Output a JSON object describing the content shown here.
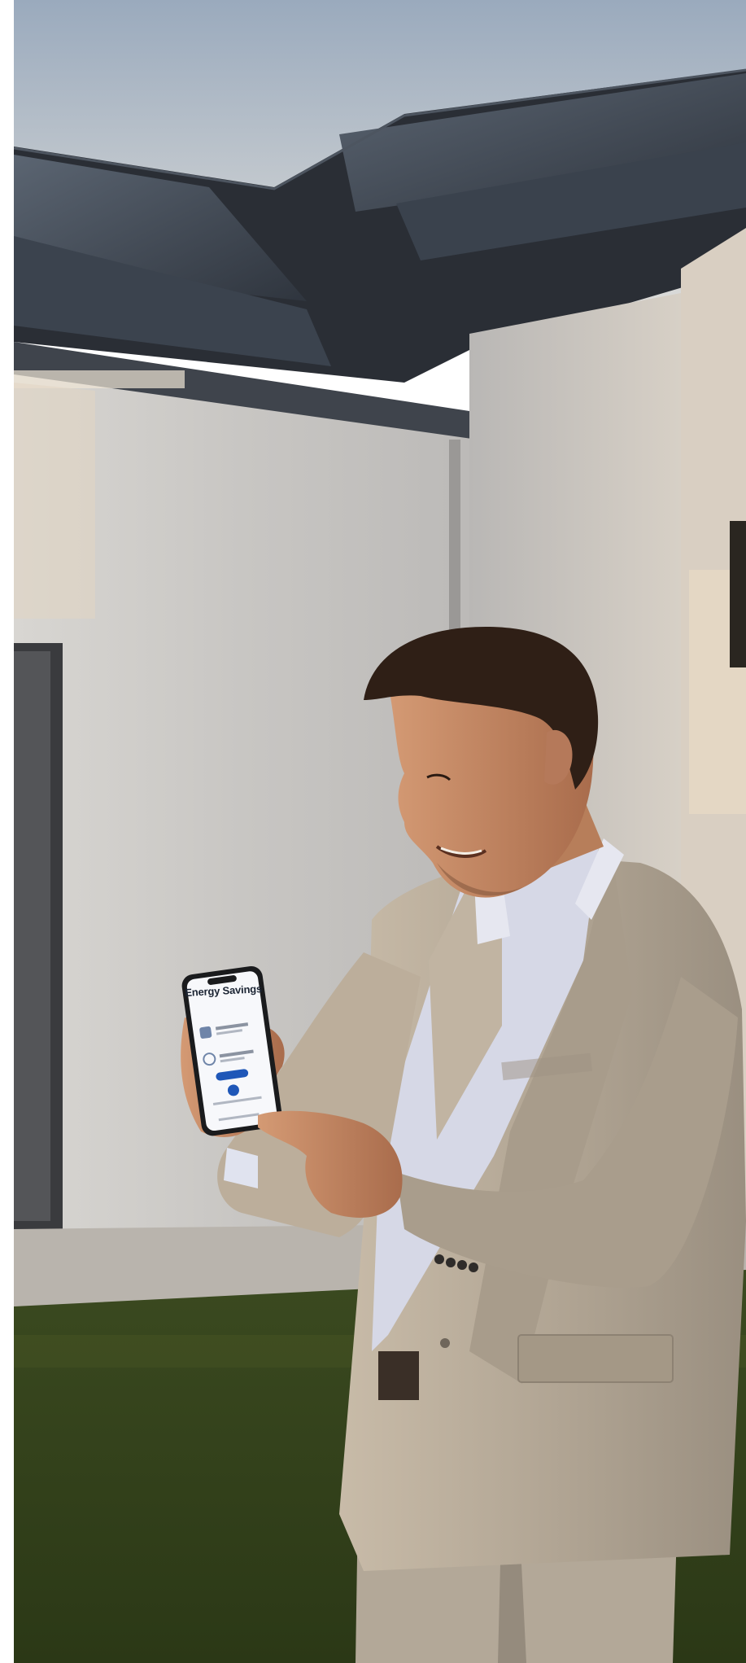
{
  "photo": {
    "subject": "man-in-suit-holding-smartphone",
    "phone_screen": {
      "app_title": "Energy Savings"
    }
  },
  "colors": {
    "sky_top": "#9fb0c2",
    "sky_bottom": "#e4e3df",
    "wall": "#c9c8c6",
    "roof": "#2b2f36",
    "grass": "#3c4a1e",
    "suit": "#b3a89a",
    "shirt": "#d9dbea",
    "accent_blue": "#1f57b8"
  }
}
